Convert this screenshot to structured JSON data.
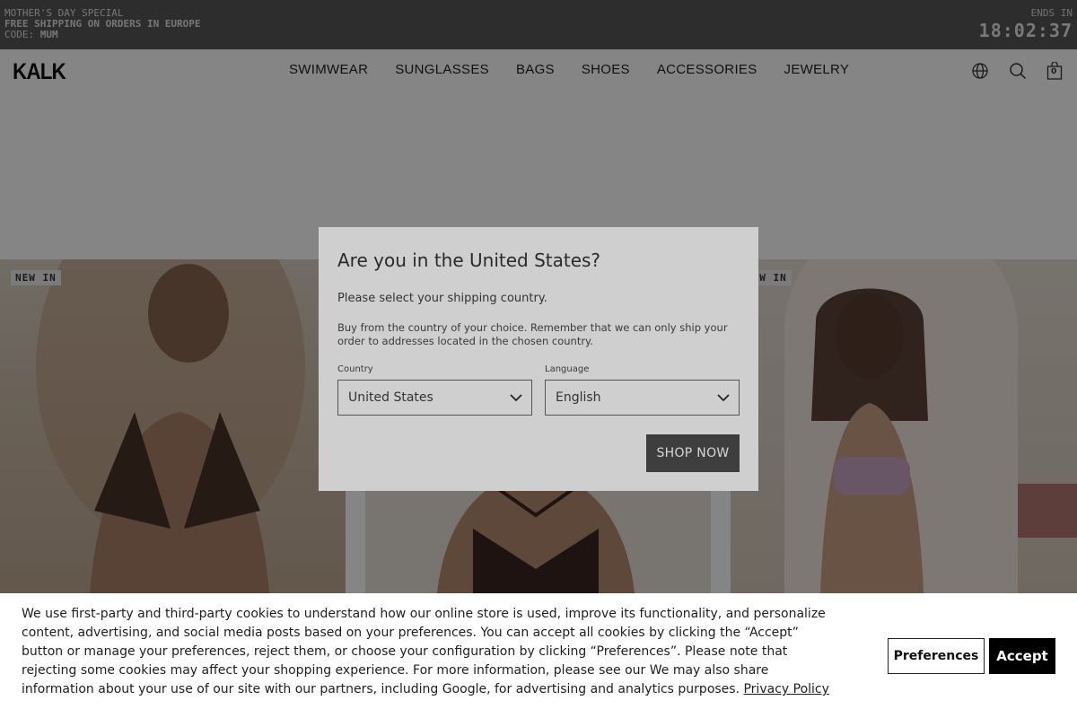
{
  "promo": {
    "line1": "MOTHER'S DAY SPECIAL",
    "line2": "FREE SHIPPING ON ORDERS IN EUROPE",
    "code_label": "CODE:",
    "code_value": "MUM",
    "ends_label": "ENDS IN",
    "timer": "18:02:37"
  },
  "header": {
    "logo": "KALK",
    "nav": [
      "SWIMWEAR",
      "SUNGLASSES",
      "BAGS",
      "SHOES",
      "ACCESSORIES",
      "JEWELRY"
    ],
    "icons": [
      "globe-icon",
      "search-icon",
      "bag-icon"
    ],
    "cart_count": "0"
  },
  "products": [
    {
      "badge": "NEW IN"
    },
    {
      "badge": ""
    },
    {
      "badge": "NEW IN"
    }
  ],
  "modal": {
    "title": "Are you in the United States?",
    "subtitle": "Please select your shipping country.",
    "body": "Buy from the country of your choice. Remember that we can only ship your order to addresses located in the chosen country.",
    "country_label": "Country",
    "country_value": "United States",
    "language_label": "Language",
    "language_value": "English",
    "shop_button": "SHOP NOW"
  },
  "cookie": {
    "text": "We use first-party and third-party cookies to understand how our online store is used, improve its functionality, and personalize content, advertising, and social media posts based on your preferences. You can accept all cookies by clicking the “Accept” button or manage your preferences, reject them, or choose your configuration by clicking “Preferences”. Please note that rejecting some cookies may affect your shopping experience. For more information, please see our We may also share information about your use of our site with our partners, including Google, for advertising and analytics purposes.",
    "policy_link": "Privacy Policy",
    "preferences_button": "Preferences",
    "accept_button": "Accept"
  },
  "colors": {
    "promo_bg": "#575757",
    "overlay": "rgba(0,0,0,0.48)",
    "button_dark": "#3e3e3e"
  }
}
